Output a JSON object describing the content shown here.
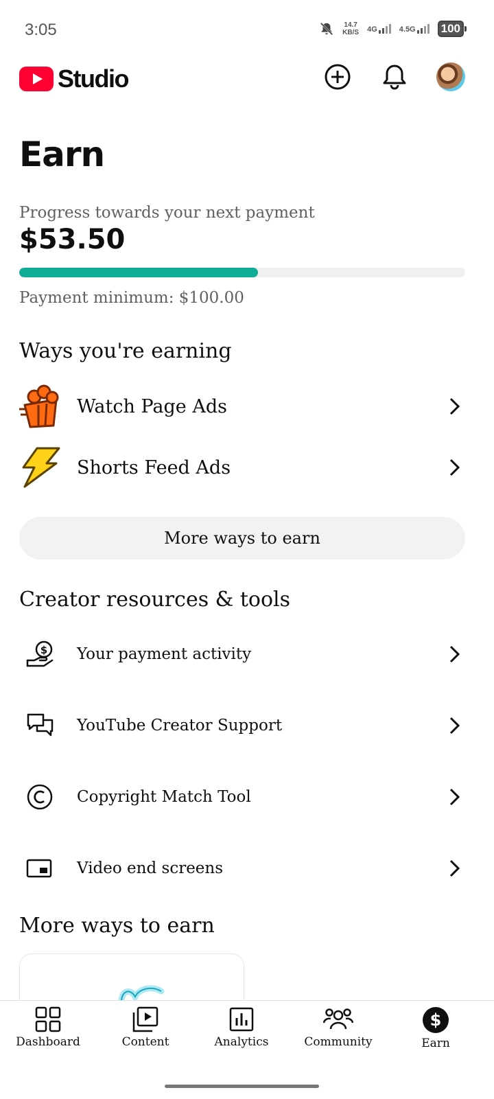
{
  "status": {
    "time": "3:05",
    "speed_value": "14.7",
    "speed_unit": "KB/S",
    "net1": "4G",
    "net2": "4.5G",
    "battery": "100"
  },
  "header": {
    "app_name": "Studio"
  },
  "page": {
    "title": "Earn"
  },
  "payment": {
    "label": "Progress towards your next payment",
    "amount": "$53.50",
    "minimum": "Payment minimum: $100.00",
    "progress_fraction": 0.535,
    "bar_color": "#0fad96"
  },
  "earning": {
    "title": "Ways you're earning",
    "items": [
      {
        "label": "Watch Page Ads",
        "icon": "popcorn-icon"
      },
      {
        "label": "Shorts Feed Ads",
        "icon": "lightning-icon"
      }
    ],
    "more_button": "More ways to earn"
  },
  "resources": {
    "title": "Creator resources & tools",
    "items": [
      {
        "label": "Your payment activity",
        "icon": "payment-hand-icon"
      },
      {
        "label": "YouTube Creator Support",
        "icon": "chat-bubbles-icon"
      },
      {
        "label": "Copyright Match Tool",
        "icon": "copyright-icon"
      },
      {
        "label": "Video end screens",
        "icon": "end-screen-icon"
      }
    ]
  },
  "more": {
    "title": "More ways to earn"
  },
  "nav": {
    "items": [
      {
        "label": "Dashboard",
        "icon": "dashboard-icon"
      },
      {
        "label": "Content",
        "icon": "content-icon"
      },
      {
        "label": "Analytics",
        "icon": "analytics-icon"
      },
      {
        "label": "Community",
        "icon": "community-icon"
      },
      {
        "label": "Earn",
        "icon": "earn-icon",
        "selected": true
      }
    ]
  },
  "colors": {
    "brand_red": "#ff0033",
    "accent": "#0fad96"
  }
}
